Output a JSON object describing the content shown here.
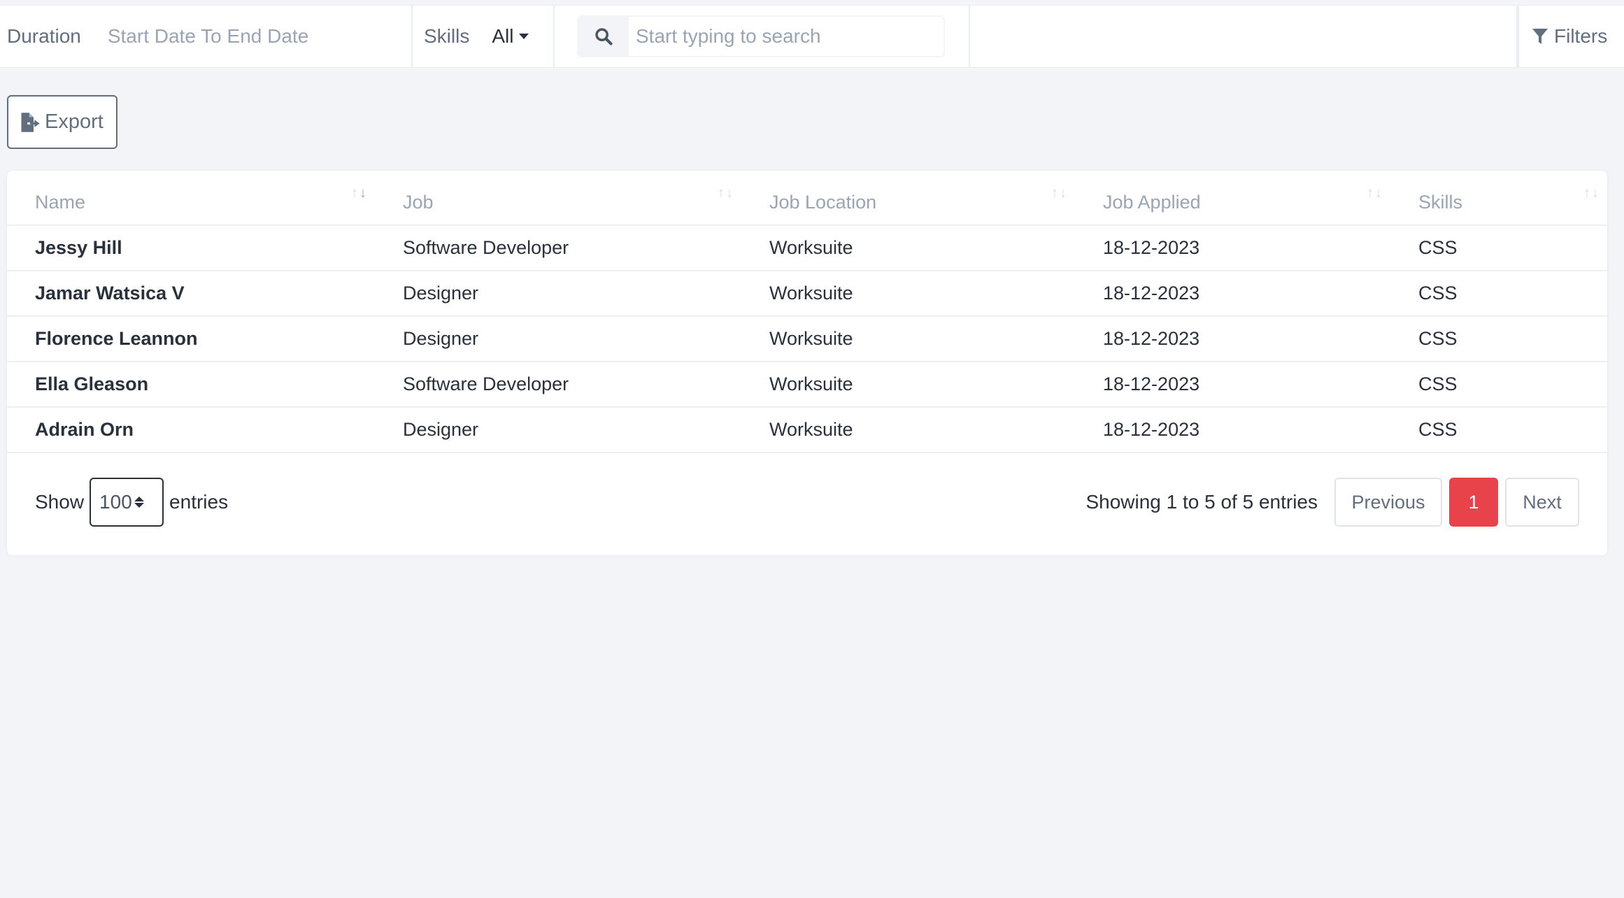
{
  "filters_bar": {
    "duration_label": "Duration",
    "duration_value": "Start Date To End Date",
    "skills_label": "Skills",
    "skills_value": "All",
    "search_placeholder": "Start typing to search",
    "search_value": "",
    "filters_label": "Filters"
  },
  "toolbar": {
    "export_label": "Export"
  },
  "table": {
    "columns": [
      "Name",
      "Job",
      "Job Location",
      "Job Applied",
      "Skills"
    ],
    "rows": [
      {
        "name": "Jessy Hill",
        "job": "Software Developer",
        "location": "Worksuite",
        "applied": "18-12-2023",
        "skills": "CSS"
      },
      {
        "name": "Jamar Watsica V",
        "job": "Designer",
        "location": "Worksuite",
        "applied": "18-12-2023",
        "skills": "CSS"
      },
      {
        "name": "Florence Leannon",
        "job": "Designer",
        "location": "Worksuite",
        "applied": "18-12-2023",
        "skills": "CSS"
      },
      {
        "name": "Ella Gleason",
        "job": "Software Developer",
        "location": "Worksuite",
        "applied": "18-12-2023",
        "skills": "CSS"
      },
      {
        "name": "Adrain Orn",
        "job": "Designer",
        "location": "Worksuite",
        "applied": "18-12-2023",
        "skills": "CSS"
      }
    ]
  },
  "footer": {
    "show_label": "Show",
    "page_size": "100",
    "entries_label": "entries",
    "info": "Showing 1 to 5 of 5 entries",
    "prev_label": "Previous",
    "current_page": "1",
    "next_label": "Next"
  },
  "colors": {
    "accent": "#e8434a",
    "background": "#f2f4f7",
    "text": "#28313c",
    "muted": "#99a5b5"
  }
}
